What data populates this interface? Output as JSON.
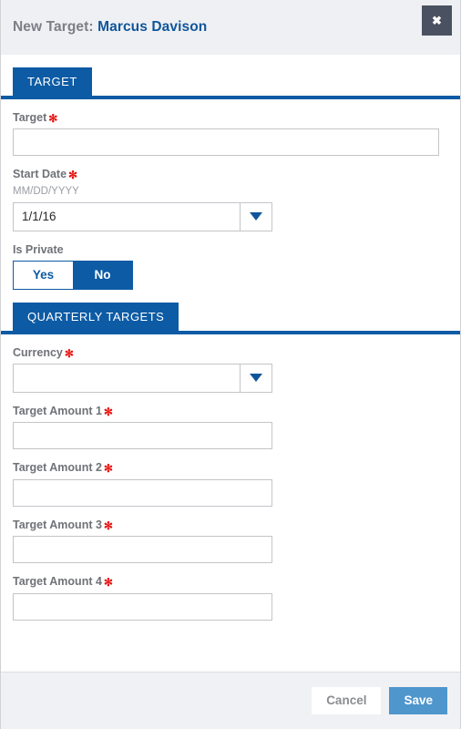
{
  "header": {
    "title_prefix": "New Target:",
    "title_name": "Marcus Davison",
    "close_icon": "close-icon",
    "close_glyph": "✖"
  },
  "sections": {
    "target": {
      "tab_label": "TARGET",
      "fields": {
        "target": {
          "label": "Target",
          "required_marker": "✻",
          "value": "",
          "placeholder": ""
        },
        "start_date": {
          "label": "Start Date",
          "required_marker": "✻",
          "format_hint": "MM/DD/YYYY",
          "value": "1/1/16",
          "placeholder": "",
          "dropdown_icon": "chevron-down-icon"
        },
        "is_private": {
          "label": "Is Private",
          "option_yes": "Yes",
          "option_no": "No",
          "selected": "No"
        }
      }
    },
    "quarterly_targets": {
      "tab_label": "QUARTERLY TARGETS",
      "fields": {
        "currency": {
          "label": "Currency",
          "required_marker": "✻",
          "value": "",
          "placeholder": "",
          "dropdown_icon": "chevron-down-icon"
        },
        "amount1": {
          "label": "Target Amount 1",
          "required_marker": "✻",
          "value": "",
          "placeholder": ""
        },
        "amount2": {
          "label": "Target Amount 2",
          "required_marker": "✻",
          "value": "",
          "placeholder": ""
        },
        "amount3": {
          "label": "Target Amount 3",
          "required_marker": "✻",
          "value": "",
          "placeholder": ""
        },
        "amount4": {
          "label": "Target Amount 4",
          "required_marker": "✻",
          "value": "",
          "placeholder": ""
        }
      }
    }
  },
  "footer": {
    "cancel_label": "Cancel",
    "save_label": "Save"
  },
  "colors": {
    "brand_blue": "#0d5ba5",
    "title_link_blue": "#10559a",
    "required_red": "#e8110f",
    "save_blue": "#4f96cd",
    "header_bg": "#eff0f4",
    "footer_bg": "#f0f1f4",
    "close_bg": "#4a5160"
  }
}
